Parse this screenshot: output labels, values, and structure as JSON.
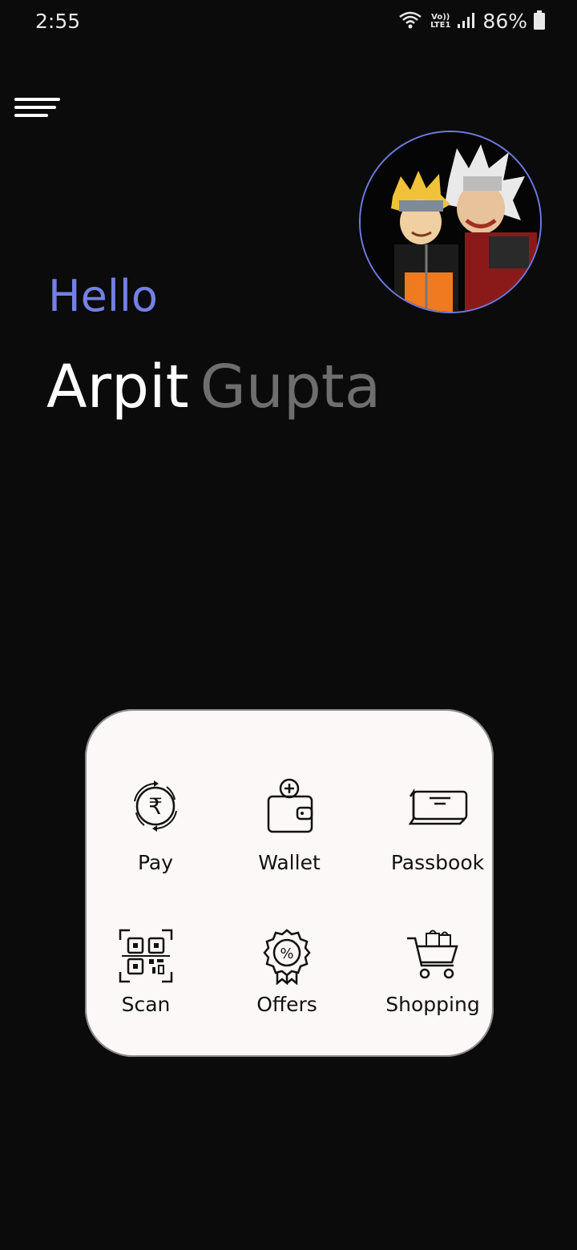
{
  "status_bar": {
    "time": "2:55",
    "battery_percent": "86%",
    "network_label_top": "Vo))",
    "network_label_bottom": "LTE1"
  },
  "greeting": {
    "hello": "Hello",
    "first_name": "Arpit",
    "last_name": "Gupta"
  },
  "colors": {
    "background": "#0b0b0b",
    "accent": "#7480e6",
    "card": "#fcf8f7",
    "muted_name": "#6e6e6e"
  },
  "actions": [
    {
      "label": "Pay",
      "icon": "rupee-cycle-icon"
    },
    {
      "label": "Wallet",
      "icon": "wallet-add-icon"
    },
    {
      "label": "Passbook",
      "icon": "passbook-icon"
    },
    {
      "label": "Scan",
      "icon": "qr-scan-icon"
    },
    {
      "label": "Offers",
      "icon": "offer-badge-icon"
    },
    {
      "label": "Shopping",
      "icon": "shopping-cart-icon"
    }
  ]
}
